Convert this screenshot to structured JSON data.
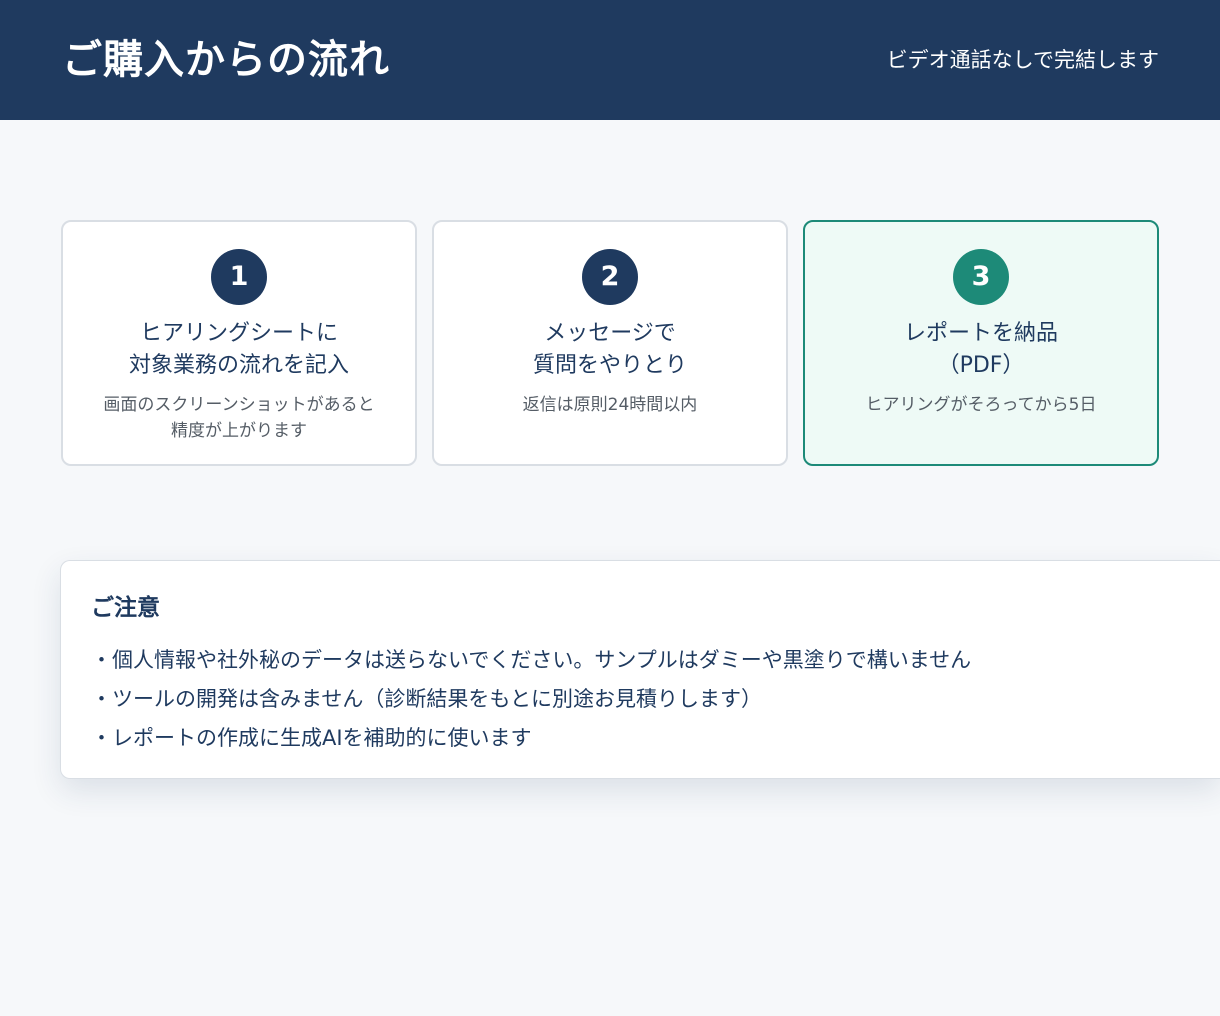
{
  "header": {
    "title": "ご購入からの流れ",
    "subtitle": "ビデオ通話なしで完結します"
  },
  "steps": [
    {
      "number": "1",
      "title_lines": [
        "ヒアリングシートに",
        "対象業務の流れを記入"
      ],
      "note_lines": [
        "画面のスクリーンショットがあると",
        "精度が上がります"
      ]
    },
    {
      "number": "2",
      "title_lines": [
        "メッセージで",
        "質問をやりとり"
      ],
      "note_lines": [
        "返信は原則24時間以内"
      ]
    },
    {
      "number": "3",
      "title_lines": [
        "レポートを納品",
        "（PDF）"
      ],
      "note_lines": [
        "ヒアリングがそろってから5日"
      ]
    }
  ],
  "colors": {
    "header_bg": "#1f3a5f",
    "accent": "#1d8a78",
    "accent_bg": "#eefaf6",
    "text": "#1f3a5f"
  },
  "notice": {
    "title": "ご注意",
    "items": [
      "・個人情報や社外秘のデータは送らないでください。サンプルはダミーや黒塗りで構いません",
      "・ツールの開発は含みません（診断結果をもとに別途お見積りします）",
      "・レポートの作成に生成AIを補助的に使います"
    ]
  }
}
